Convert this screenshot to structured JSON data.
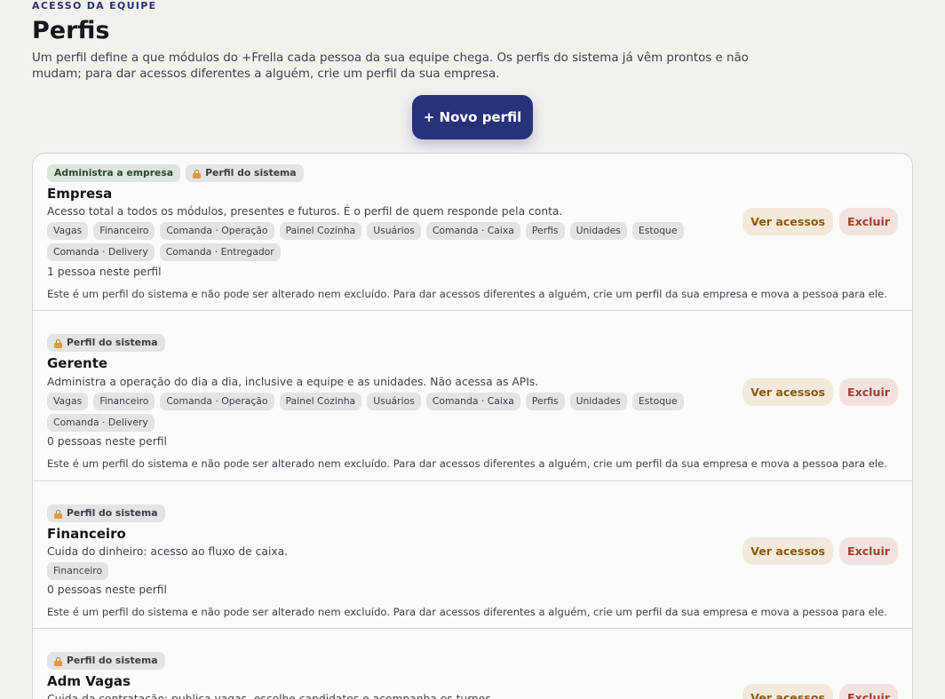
{
  "header": {
    "eyebrow": "ACESSO DA EQUIPE",
    "title": "Perfis",
    "description": "Um perfil define a que módulos do +Frella cada pessoa da sua equipe chega. Os perfis do sistema já vêm prontos e não mudam; para dar acessos diferentes a alguém, crie um perfil da sua empresa.",
    "new_profile_label": "+ Novo perfil"
  },
  "labels": {
    "admin_badge": "Administra a empresa",
    "system_badge": "Perfil do sistema",
    "view_access": "Ver acessos",
    "delete": "Excluir",
    "system_note": "Este é um perfil do sistema e não pode ser alterado nem excluído. Para dar acessos diferentes a alguém, crie um perfil da sua empresa e mova a pessoa para ele."
  },
  "profiles": [
    {
      "name": "Empresa",
      "description": "Acesso total a todos os módulos, presentes e futuros. É o perfil de quem responde pela conta.",
      "modules": [
        "Vagas",
        "Financeiro",
        "Comanda · Operação",
        "Painel Cozinha",
        "Usuários",
        "Comanda · Caixa",
        "Perfis",
        "Unidades",
        "Estoque",
        "Comanda · Delivery",
        "Comanda · Entregador"
      ],
      "people_count": "1 pessoa neste perfil"
    },
    {
      "name": "Gerente",
      "description": "Administra a operação do dia a dia, inclusive a equipe e as unidades. Não acessa as APIs.",
      "modules": [
        "Vagas",
        "Financeiro",
        "Comanda · Operação",
        "Painel Cozinha",
        "Usuários",
        "Comanda · Caixa",
        "Perfis",
        "Unidades",
        "Estoque",
        "Comanda · Delivery"
      ],
      "people_count": "0 pessoas neste perfil"
    },
    {
      "name": "Financeiro",
      "description": "Cuida do dinheiro: acesso ao fluxo de caixa.",
      "modules": [
        "Financeiro"
      ],
      "people_count": "0 pessoas neste perfil"
    },
    {
      "name": "Adm Vagas",
      "description": "Cuida da contratação: publica vagas, escolhe candidatos e acompanha os turnos."
    }
  ],
  "icons": {
    "lock": "lock-icon"
  }
}
